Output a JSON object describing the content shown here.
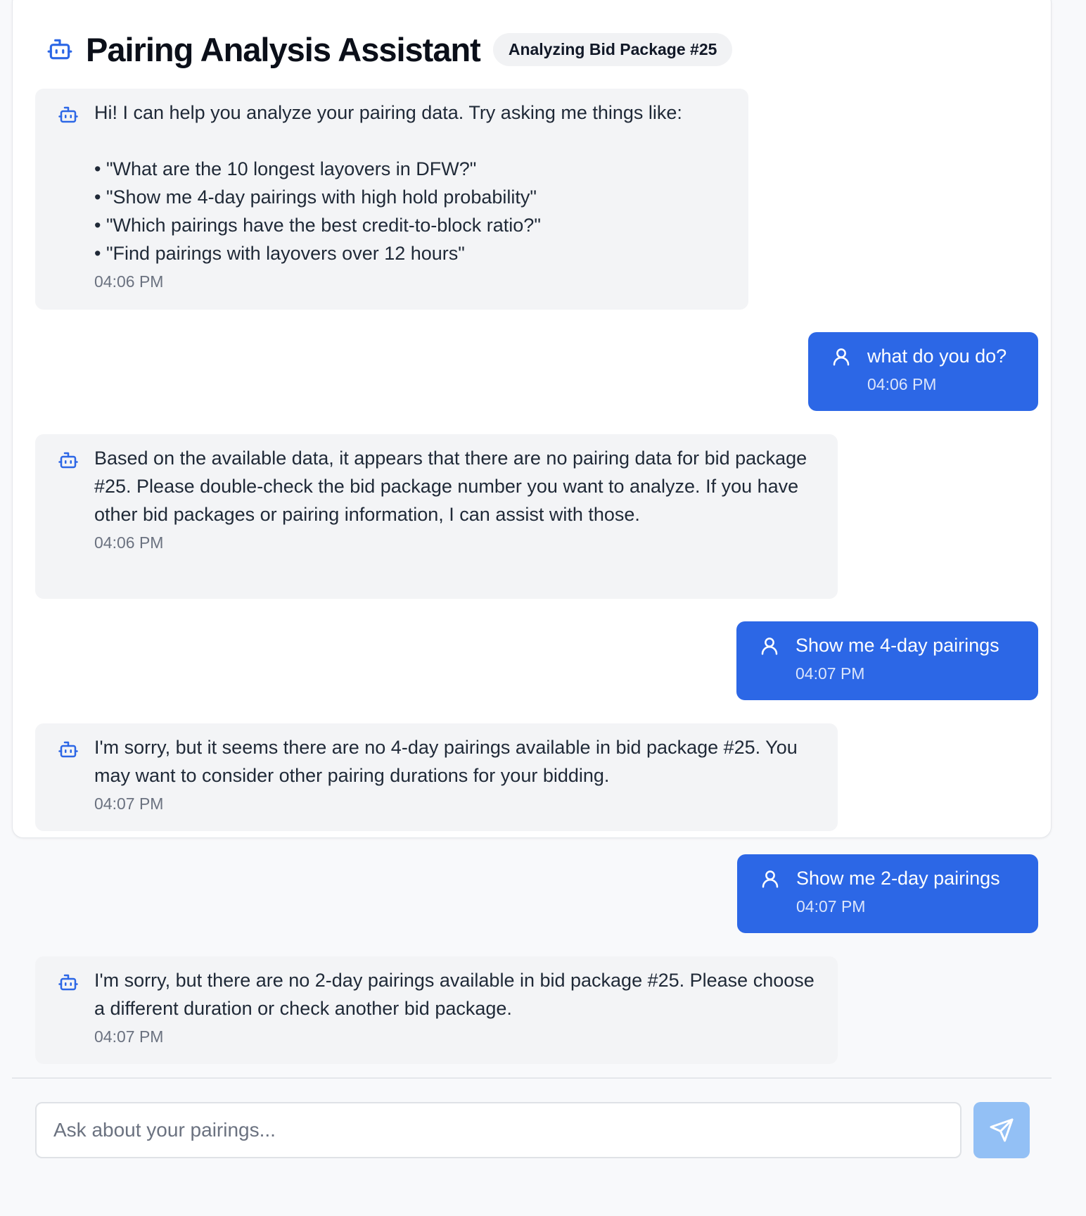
{
  "header": {
    "title": "Pairing Analysis Assistant",
    "badge": "Analyzing Bid Package #25",
    "icon": "bot-icon"
  },
  "messages": [
    {
      "role": "assistant",
      "icon": "bot-icon",
      "text": "Hi! I can help you analyze your pairing data. Try asking me things like:\n\n• \"What are the 10 longest layovers in DFW?\"\n• \"Show me 4-day pairings with high hold probability\"\n• \"Which pairings have the best credit-to-block ratio?\"\n• \"Find pairings with layovers over 12 hours\"",
      "time": "04:06 PM"
    },
    {
      "role": "user",
      "icon": "user-icon",
      "text": "what do you do?",
      "time": "04:06 PM"
    },
    {
      "role": "assistant",
      "icon": "bot-icon",
      "text": "Based on the available data, it appears that there are no pairing data for bid package #25. Please double-check the bid package number you want to analyze. If you have other bid packages or pairing information, I can assist with those.",
      "time": "04:06 PM"
    },
    {
      "role": "user",
      "icon": "user-icon",
      "text": "Show me 4-day pairings",
      "time": "04:07 PM"
    },
    {
      "role": "assistant",
      "icon": "bot-icon",
      "text": "I'm sorry, but it seems there are no 4-day pairings available in bid package #25. You may want to consider other pairing durations for your bidding.",
      "time": "04:07 PM"
    },
    {
      "role": "user",
      "icon": "user-icon",
      "text": "Show me 2-day pairings",
      "time": "04:07 PM"
    },
    {
      "role": "assistant",
      "icon": "bot-icon",
      "text": "I'm sorry, but there are no 2-day pairings available in bid package #25. Please choose a different duration or check another bid package.",
      "time": "04:07 PM"
    }
  ],
  "composer": {
    "placeholder": "Ask about your pairings...",
    "value": "",
    "send_icon": "send-icon"
  },
  "colors": {
    "accent": "#2c67e6",
    "bot_bubble": "#f3f4f6",
    "send_disabled": "#93c0f5"
  }
}
